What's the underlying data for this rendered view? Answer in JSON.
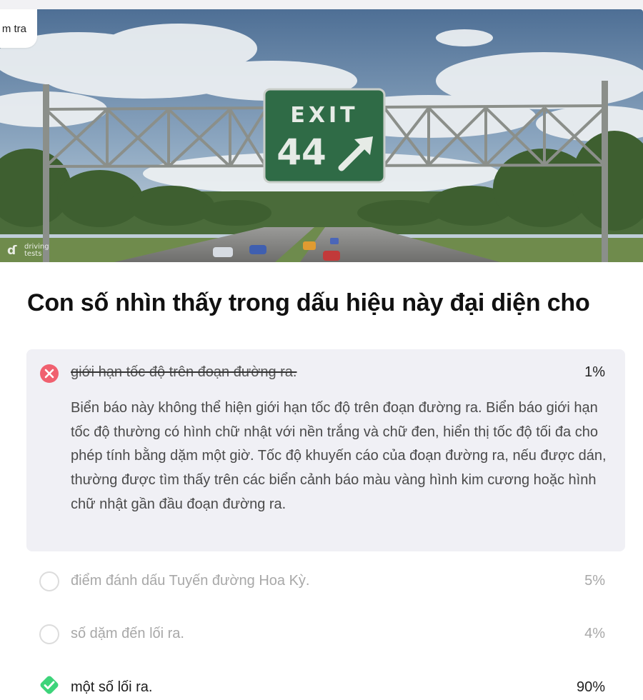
{
  "badge": {
    "label": "m tra"
  },
  "hero": {
    "sign": {
      "title": "EXIT",
      "number": "44"
    },
    "watermark": {
      "line1": "driving",
      "line2": "tests"
    }
  },
  "question": {
    "text": "Con số nhìn thấy trong dấu hiệu này đại diện cho"
  },
  "answers": [
    {
      "text": "giới hạn tốc độ trên đoạn đường ra.",
      "percent": "1%",
      "state": "incorrect-selected",
      "icon": "x-circle-icon",
      "explanation": "Biển báo này không thể hiện giới hạn tốc độ trên đoạn đường ra. Biển báo giới hạn tốc độ thường có hình chữ nhật với nền trắng và chữ đen, hiển thị tốc độ tối đa cho phép tính bằng dặm một giờ. Tốc độ khuyến cáo của đoạn đường ra, nếu được dán, thường được tìm thấy trên các biển cảnh báo màu vàng hình kim cương hoặc hình chữ nhật gần đầu đoạn đường ra."
    },
    {
      "text": "điểm đánh dấu Tuyến đường Hoa Kỳ.",
      "percent": "5%",
      "state": "unselected",
      "icon": "empty-circle-icon"
    },
    {
      "text": "số dặm đến lối ra.",
      "percent": "4%",
      "state": "unselected",
      "icon": "empty-circle-icon"
    },
    {
      "text": "một số lối ra.",
      "percent": "90%",
      "state": "correct",
      "icon": "check-diamond-icon"
    }
  ],
  "colors": {
    "incorrect": "#f0606f",
    "correct": "#3dd47a",
    "selected_bg": "#f0f0f5",
    "sign_green": "#2f6b46"
  }
}
